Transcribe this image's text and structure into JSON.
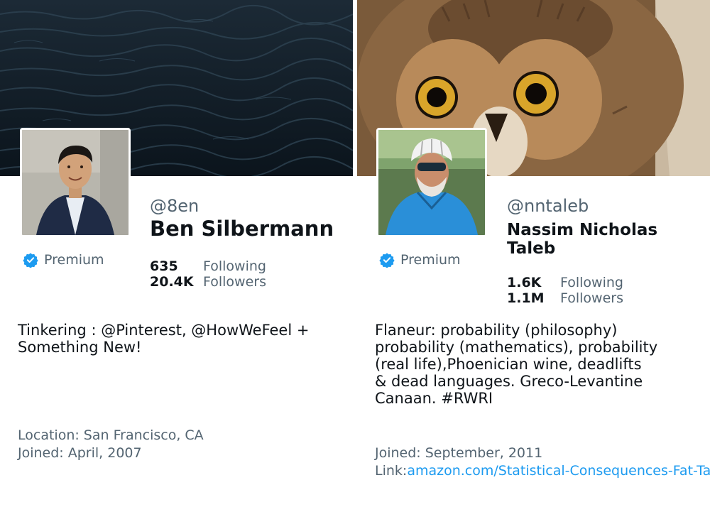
{
  "profiles": [
    {
      "handle": "@8en",
      "name": "Ben Silbermann",
      "premium_label": "Premium",
      "following_count": "635",
      "following_label": "Following",
      "followers_count": "20.4K",
      "followers_label": "Followers",
      "bio": "Tinkering : @Pinterest, @HowWeFeel +\nSomething New!",
      "location": "Location: San Francisco, CA",
      "joined": "Joined: April, 2007",
      "banner": "dark-water-photo",
      "avatar": "man-portrait-photo"
    },
    {
      "handle": "@nntaleb",
      "name": "Nassim Nicholas Taleb",
      "premium_label": "Premium",
      "following_count": "1.6K",
      "following_label": "Following",
      "followers_count": "1.1M",
      "followers_label": "Followers",
      "bio": "Flaneur: probability (philosophy)\nprobability (mathematics), probability\n(real life),Phoenician wine, deadlifts\n& dead languages. Greco-Levantine\nCanaan. #RWRI",
      "joined": "Joined: September, 2011",
      "link_label": "Link:",
      "link_url": "amazon.com/Statistical-Consequences-Fat-Tai",
      "banner": "owl-closeup-photo",
      "avatar": "cyclist-portrait-photo"
    }
  ],
  "colors": {
    "verified_blue": "#1d9bf0",
    "secondary_text": "#536471",
    "primary_text": "#0f1419"
  }
}
